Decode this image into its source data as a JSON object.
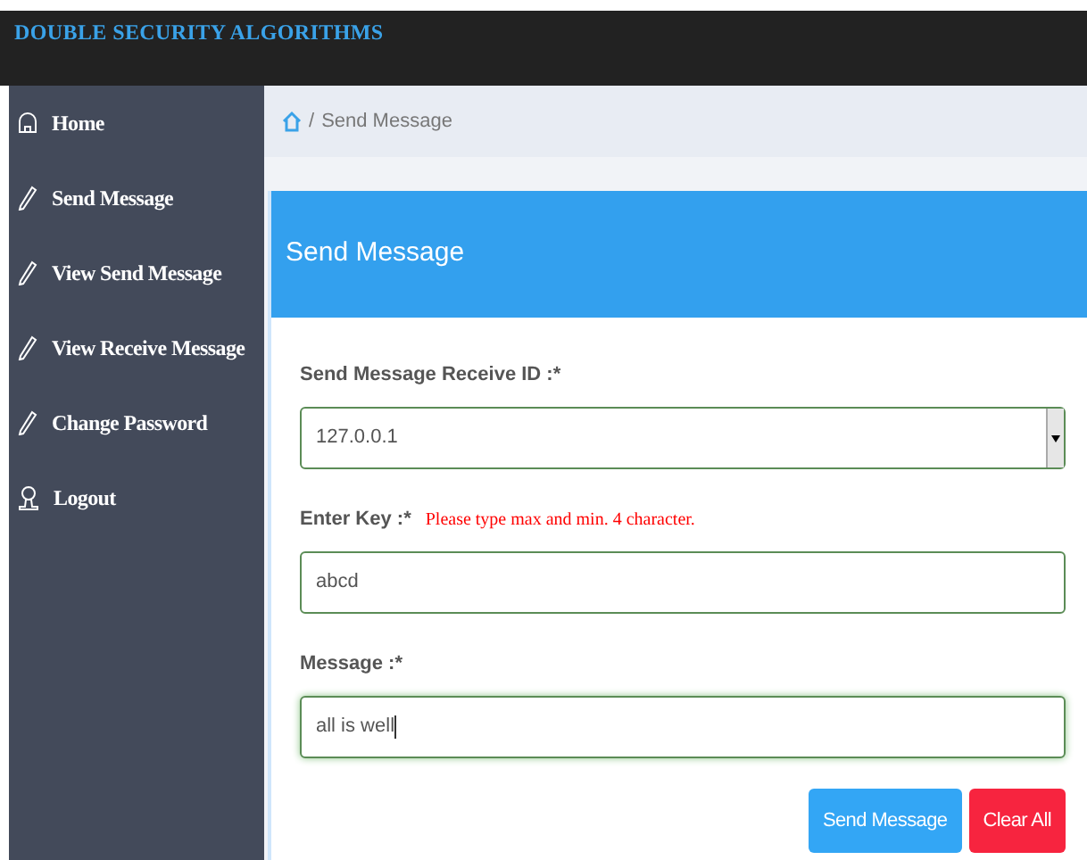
{
  "header": {
    "title": "DOUBLE SECURITY ALGORITHMS"
  },
  "sidebar": {
    "items": [
      {
        "label": "Home",
        "kind": "home"
      },
      {
        "label": "Send Message",
        "kind": "pencil"
      },
      {
        "label": "View Send Message",
        "kind": "pencil"
      },
      {
        "label": "View Receive Message",
        "kind": "pencil"
      },
      {
        "label": "Change Password",
        "kind": "pencil"
      },
      {
        "label": "Logout",
        "kind": "user"
      }
    ]
  },
  "breadcrumb": {
    "separator": "/",
    "current": "Send Message"
  },
  "card": {
    "title": "Send Message",
    "fields": [
      {
        "kind": "select",
        "label": "Send Message Receive ID :*",
        "value": "127.0.0.1"
      },
      {
        "kind": "input",
        "label": "Enter Key :*",
        "hint": "Please type max and min. 4 character.",
        "value": "abcd",
        "focused": false
      },
      {
        "kind": "input",
        "label": "Message :*",
        "value": "all is well",
        "focused": true
      }
    ],
    "buttons": [
      {
        "label": "Send Message",
        "kind": "primary"
      },
      {
        "label": "Clear All",
        "kind": "danger"
      }
    ]
  }
}
